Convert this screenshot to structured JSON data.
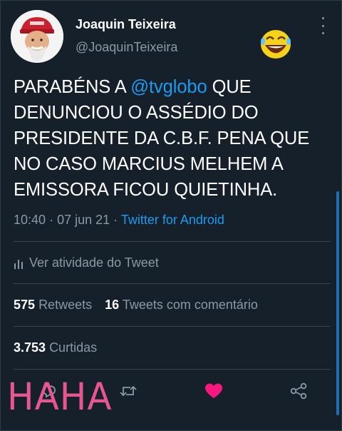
{
  "tweet": {
    "display_name": "Joaquin Teixeira",
    "handle": "@JoaquinTeixeira",
    "text_before": "PARABÉNS A ",
    "mention": "@tvglobo",
    "text_after": " QUE DENUNCIOU O ASSÉDIO DO PRESIDENTE DA C.B.F. PENA QUE NO CASO MARCIUS MELHEM A EMISSORA FICOU QUIETINHA.",
    "time": "10:40",
    "date": "07 jun 21",
    "separator": "·",
    "source": "Twitter for Android"
  },
  "activity_label": "Ver atividade do Tweet",
  "stats": {
    "retweets_count": "575",
    "retweets_label": "Retweets",
    "quotes_count": "16",
    "quotes_label": "Tweets com comentário",
    "likes_count": "3.753",
    "likes_label": "Curtidas"
  },
  "overlay_text": "HAHA",
  "icons": {
    "more": "more-vertical-icon",
    "emoji": "laughing-emoji-icon",
    "activity": "bar-chart-icon",
    "reply": "reply-icon",
    "retweet": "retweet-icon",
    "like": "heart-icon",
    "share": "share-icon"
  },
  "colors": {
    "background": "#15202b",
    "link": "#1d9bf0",
    "secondary_text": "#8b98a5",
    "like": "#f91880",
    "overlay": "#e8568f"
  }
}
